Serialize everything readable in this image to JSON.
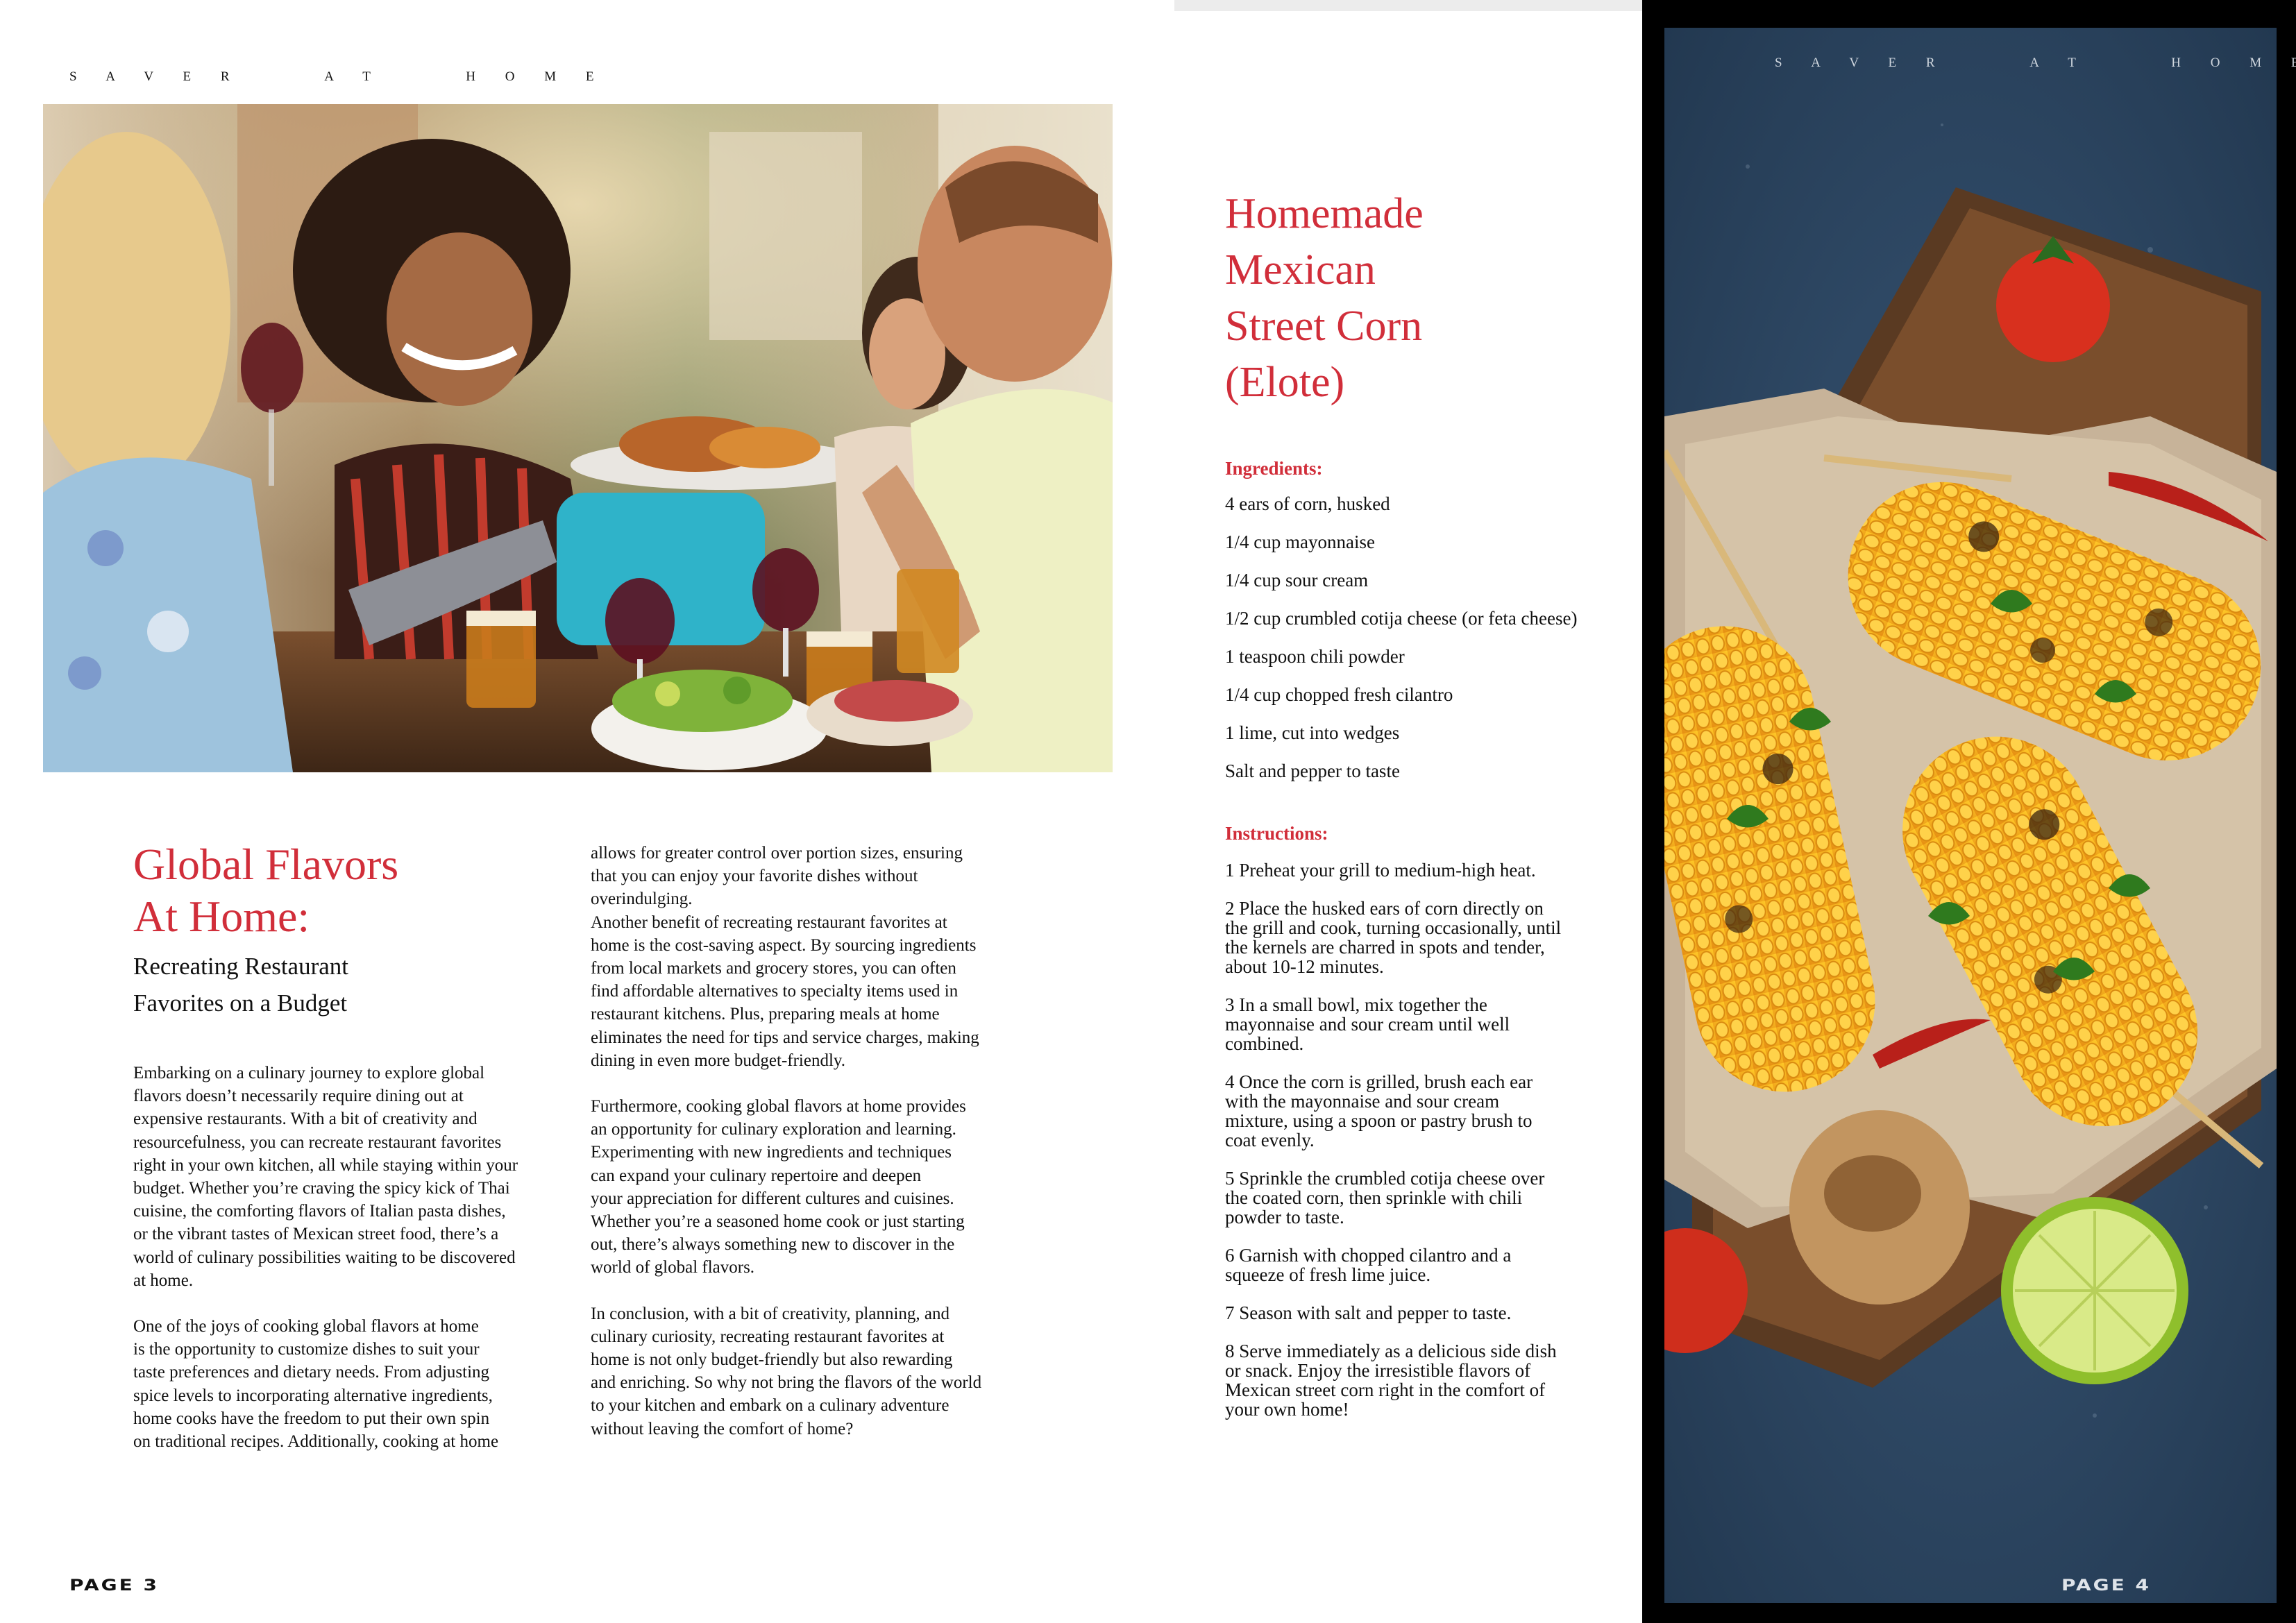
{
  "spread": {
    "masthead": "S A V E R     A T     H O M E",
    "left_page": {
      "folio": "PAGE 3",
      "hero_image_alt": "",
      "title_line1": "Global Flavors",
      "title_line2": "At Home:",
      "subtitle_line1": "Recreating Restaurant",
      "subtitle_line2": "Favorites on a Budget",
      "column_1": [
        "Embarking on a culinary journey to explore global\nflavors doesn’t necessarily require dining out at\nexpensive restaurants. With a bit of creativity and\nresourcefulness, you can recreate restaurant favorites\nright in your own kitchen, all while staying within your\nbudget. Whether you’re craving the spicy kick of Thai\ncuisine, the comforting flavors of Italian pasta dishes,\nor the vibrant tastes of Mexican street food, there’s a\nworld of culinary possibilities waiting to be discovered\nat home.",
        "One of the joys of cooking global flavors at home\nis the opportunity to customize dishes to suit your\ntaste preferences and dietary needs. From adjusting\nspice levels to incorporating alternative ingredients,\nhome cooks have the freedom to put their own spin\non traditional recipes. Additionally, cooking at home"
      ],
      "column_2": [
        "allows for greater control over portion sizes, ensuring\nthat you can enjoy your favorite dishes without\noverindulging.\nAnother benefit of recreating restaurant favorites at\nhome is the cost-saving aspect. By sourcing ingredients\nfrom local markets and grocery stores, you can often\nfind affordable alternatives to specialty items used in\nrestaurant kitchens. Plus, preparing meals at home\neliminates the need for tips and service charges, making\ndining in even more budget-friendly.",
        "Furthermore, cooking global flavors at home provides\nan opportunity for culinary exploration and learning.\nExperimenting with new ingredients and techniques\ncan expand your culinary repertoire and deepen\nyour appreciation for different cultures and cuisines.\nWhether you’re a seasoned home cook or just starting\nout, there’s always something new to discover in the\nworld of global flavors.",
        "In conclusion, with a bit of creativity, planning, and\nculinary curiosity, recreating restaurant favorites at\nhome is not only budget-friendly but also rewarding\nand enriching. So why not bring the flavors of the world\nto your kitchen and embark on a culinary adventure\nwithout leaving the comfort of home?"
      ]
    },
    "right_page": {
      "folio": "PAGE 4",
      "recipe_title_lines": [
        "Homemade",
        "Mexican",
        "Street Corn",
        "(Elote)"
      ],
      "ingredients_label": "Ingredients:",
      "ingredients": [
        "4 ears of corn, husked",
        "1/4 cup mayonnaise",
        "1/4 cup sour cream",
        "1/2 cup crumbled cotija cheese (or feta cheese)",
        "1 teaspoon chili powder",
        "1/4 cup chopped fresh cilantro",
        "1 lime, cut into wedges",
        "Salt and pepper to taste"
      ],
      "instructions_label": "Instructions:",
      "instructions": [
        "1 Preheat your grill to medium-high heat.",
        "2 Place the husked ears of corn directly on the grill and cook, turning occasionally, until the kernels are charred in spots and tender, about 10-12 minutes.",
        "3 In a small bowl, mix together the mayonnaise and sour cream until well combined.",
        "4 Once the corn is grilled, brush each ear with the mayonnaise and sour cream mixture, using a spoon or pastry brush to coat evenly.",
        "5 Sprinkle the crumbled cotija cheese over the coated corn, then sprinkle with chili powder to taste.",
        "6 Garnish with chopped cilantro and a squeeze of fresh lime juice.",
        "7 Season with salt and pepper to taste.",
        "8 Serve immediately as a delicious side dish or snack. Enjoy the irresistible flavors of Mexican street corn right in the comfort of your own home!"
      ]
    },
    "colors": {
      "accent_red": "#d12e3a",
      "corn_background": "#2f4b68",
      "corn_yellow": "#f2a91f"
    }
  }
}
